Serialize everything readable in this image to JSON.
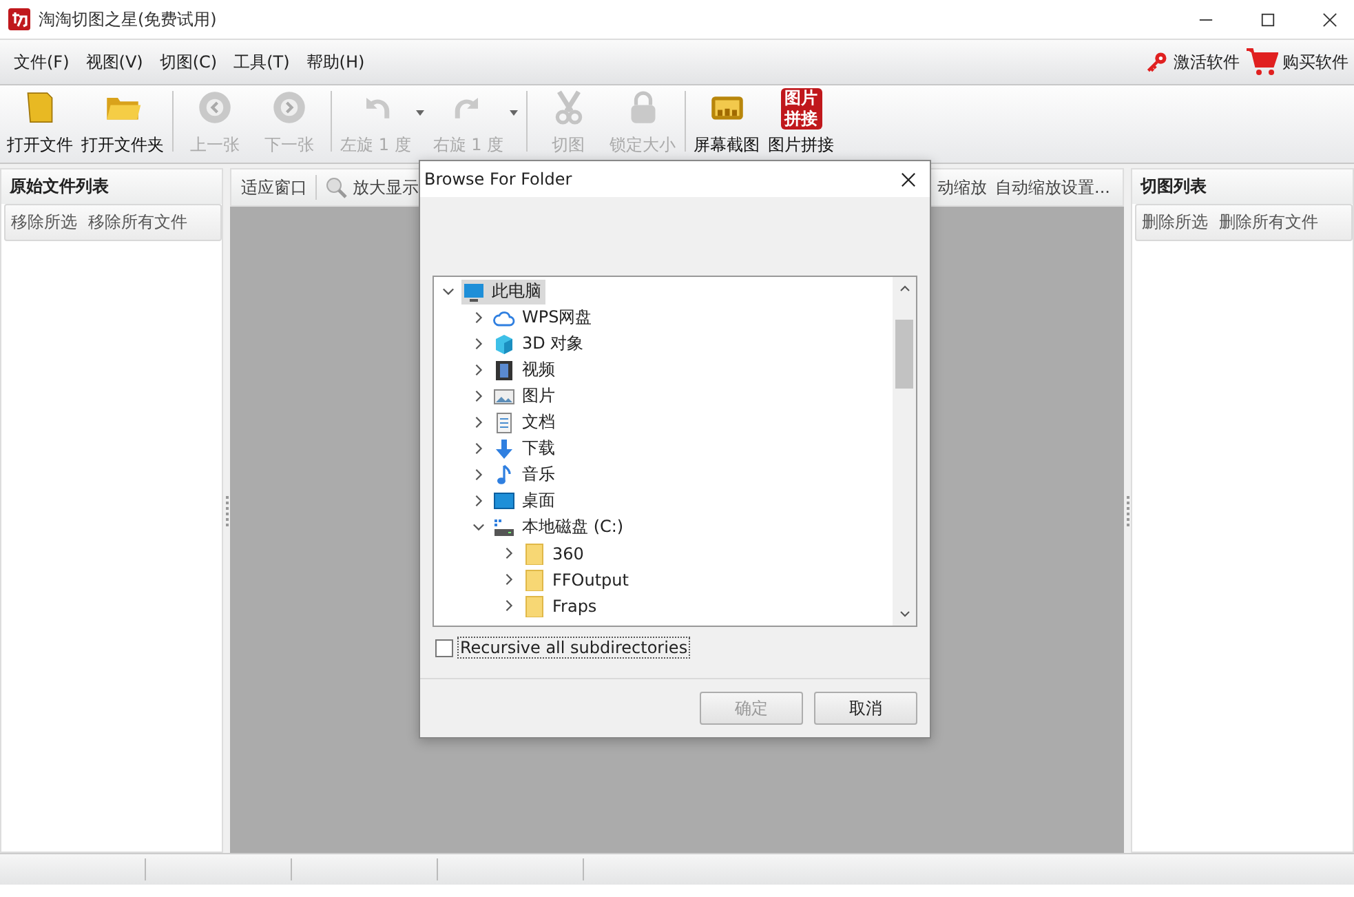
{
  "window": {
    "title": "淘淘切图之星(免费试用)"
  },
  "menu": {
    "items": [
      "文件(F)",
      "视图(V)",
      "切图(C)",
      "工具(T)",
      "帮助(H)"
    ],
    "links": [
      {
        "kind": "key",
        "label": "激活软件"
      },
      {
        "kind": "cart",
        "label": "购买软件"
      }
    ]
  },
  "toolbar": {
    "groups": [
      [
        {
          "kind": "file",
          "label": "打开文件",
          "disabled": false,
          "dropdown": false
        },
        {
          "kind": "folder",
          "label": "打开文件夹",
          "disabled": false,
          "dropdown": false
        }
      ],
      [
        {
          "kind": "prev",
          "label": "上一张",
          "disabled": true,
          "dropdown": false
        },
        {
          "kind": "next",
          "label": "下一张",
          "disabled": true,
          "dropdown": false
        }
      ],
      [
        {
          "kind": "rotate-left",
          "label": "左旋 1 度",
          "disabled": true,
          "dropdown": true
        },
        {
          "kind": "rotate-right",
          "label": "右旋 1 度",
          "disabled": true,
          "dropdown": true
        }
      ],
      [
        {
          "kind": "scissors",
          "label": "切图",
          "disabled": true,
          "dropdown": false
        },
        {
          "kind": "lock",
          "label": "锁定大小",
          "disabled": true,
          "dropdown": false
        }
      ],
      [
        {
          "kind": "screen",
          "label": "屏幕截图",
          "disabled": false,
          "dropdown": false
        },
        {
          "kind": "collage",
          "label": "图片拼接",
          "badge": [
            "图片",
            "拼接"
          ],
          "disabled": false,
          "dropdown": false
        }
      ]
    ]
  },
  "left_panel": {
    "title": "原始文件列表",
    "buttons": [
      "移除所选",
      "移除所有文件"
    ]
  },
  "viewer": {
    "left_tools": [
      {
        "kind": "text",
        "label": "适应窗口"
      },
      {
        "kind": "zoom",
        "label": "放大显示"
      }
    ],
    "right_tools": [
      "动缩放",
      "自动缩放设置..."
    ]
  },
  "right_panel": {
    "title": "切图列表",
    "buttons": [
      "删除所选",
      "删除所有文件"
    ]
  },
  "dialog": {
    "title": "Browse For Folder",
    "tree": [
      {
        "kind": "computer",
        "label": "此电脑",
        "expanded": true,
        "selected": true,
        "children": [
          {
            "kind": "cloud",
            "label": "WPS网盘",
            "expanded": false,
            "selected": false
          },
          {
            "kind": "cube",
            "label": "3D 对象",
            "expanded": false,
            "selected": false
          },
          {
            "kind": "video",
            "label": "视频",
            "expanded": false,
            "selected": false
          },
          {
            "kind": "picture",
            "label": "图片",
            "expanded": false,
            "selected": false
          },
          {
            "kind": "document",
            "label": "文档",
            "expanded": false,
            "selected": false
          },
          {
            "kind": "download",
            "label": "下载",
            "expanded": false,
            "selected": false
          },
          {
            "kind": "music",
            "label": "音乐",
            "expanded": false,
            "selected": false
          },
          {
            "kind": "desktop",
            "label": "桌面",
            "expanded": false,
            "selected": false
          },
          {
            "kind": "drive",
            "label": "本地磁盘 (C:)",
            "expanded": true,
            "selected": false,
            "children": [
              {
                "kind": "folder",
                "label": "360",
                "expanded": false,
                "selected": false
              },
              {
                "kind": "folder",
                "label": "FFOutput",
                "expanded": false,
                "selected": false
              },
              {
                "kind": "folder",
                "label": "Fraps",
                "expanded": false,
                "selected": false
              }
            ]
          }
        ]
      }
    ],
    "checkbox": {
      "label": "Recursive all subdirectories",
      "checked": false
    },
    "buttons": [
      {
        "label": "确定",
        "disabled": true
      },
      {
        "label": "取消",
        "disabled": false
      }
    ]
  }
}
